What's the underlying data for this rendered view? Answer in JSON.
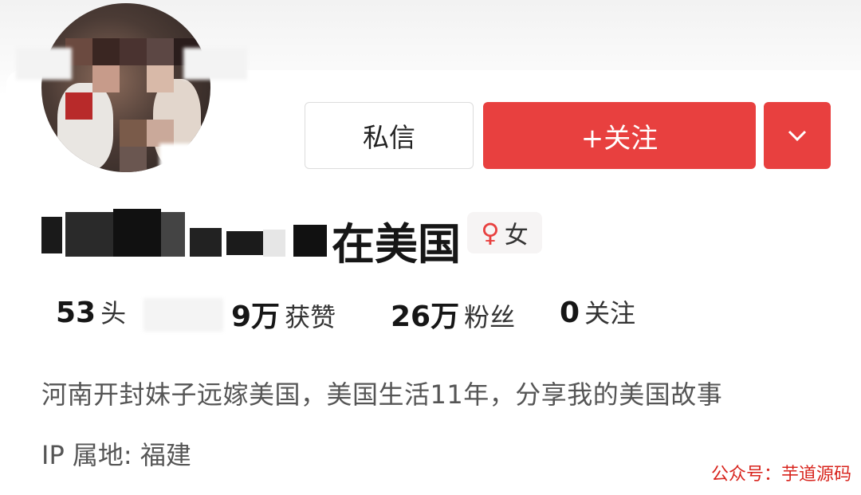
{
  "profile": {
    "name_visible": "在美国",
    "gender_symbol": "♀",
    "gender_label": "女",
    "bio": "河南开封妹子远嫁美国，美国生活11年，分享我的美国故事",
    "ip_location": "IP 属地: 福建"
  },
  "actions": {
    "message_label": "私信",
    "follow_label": "+关注",
    "more_icon": "chevron-down-icon"
  },
  "stats": [
    {
      "value": "53",
      "label": "头"
    },
    {
      "value": "9万",
      "label": "获赞"
    },
    {
      "value": "26万",
      "label": "粉丝"
    },
    {
      "value": "0",
      "label": "关注"
    }
  ],
  "watermark": "公众号：芋道源码",
  "colors": {
    "accent_red": "#e8403f",
    "text_dark": "#161616",
    "text_gray": "#555555",
    "watermark_red": "#d8251e"
  }
}
